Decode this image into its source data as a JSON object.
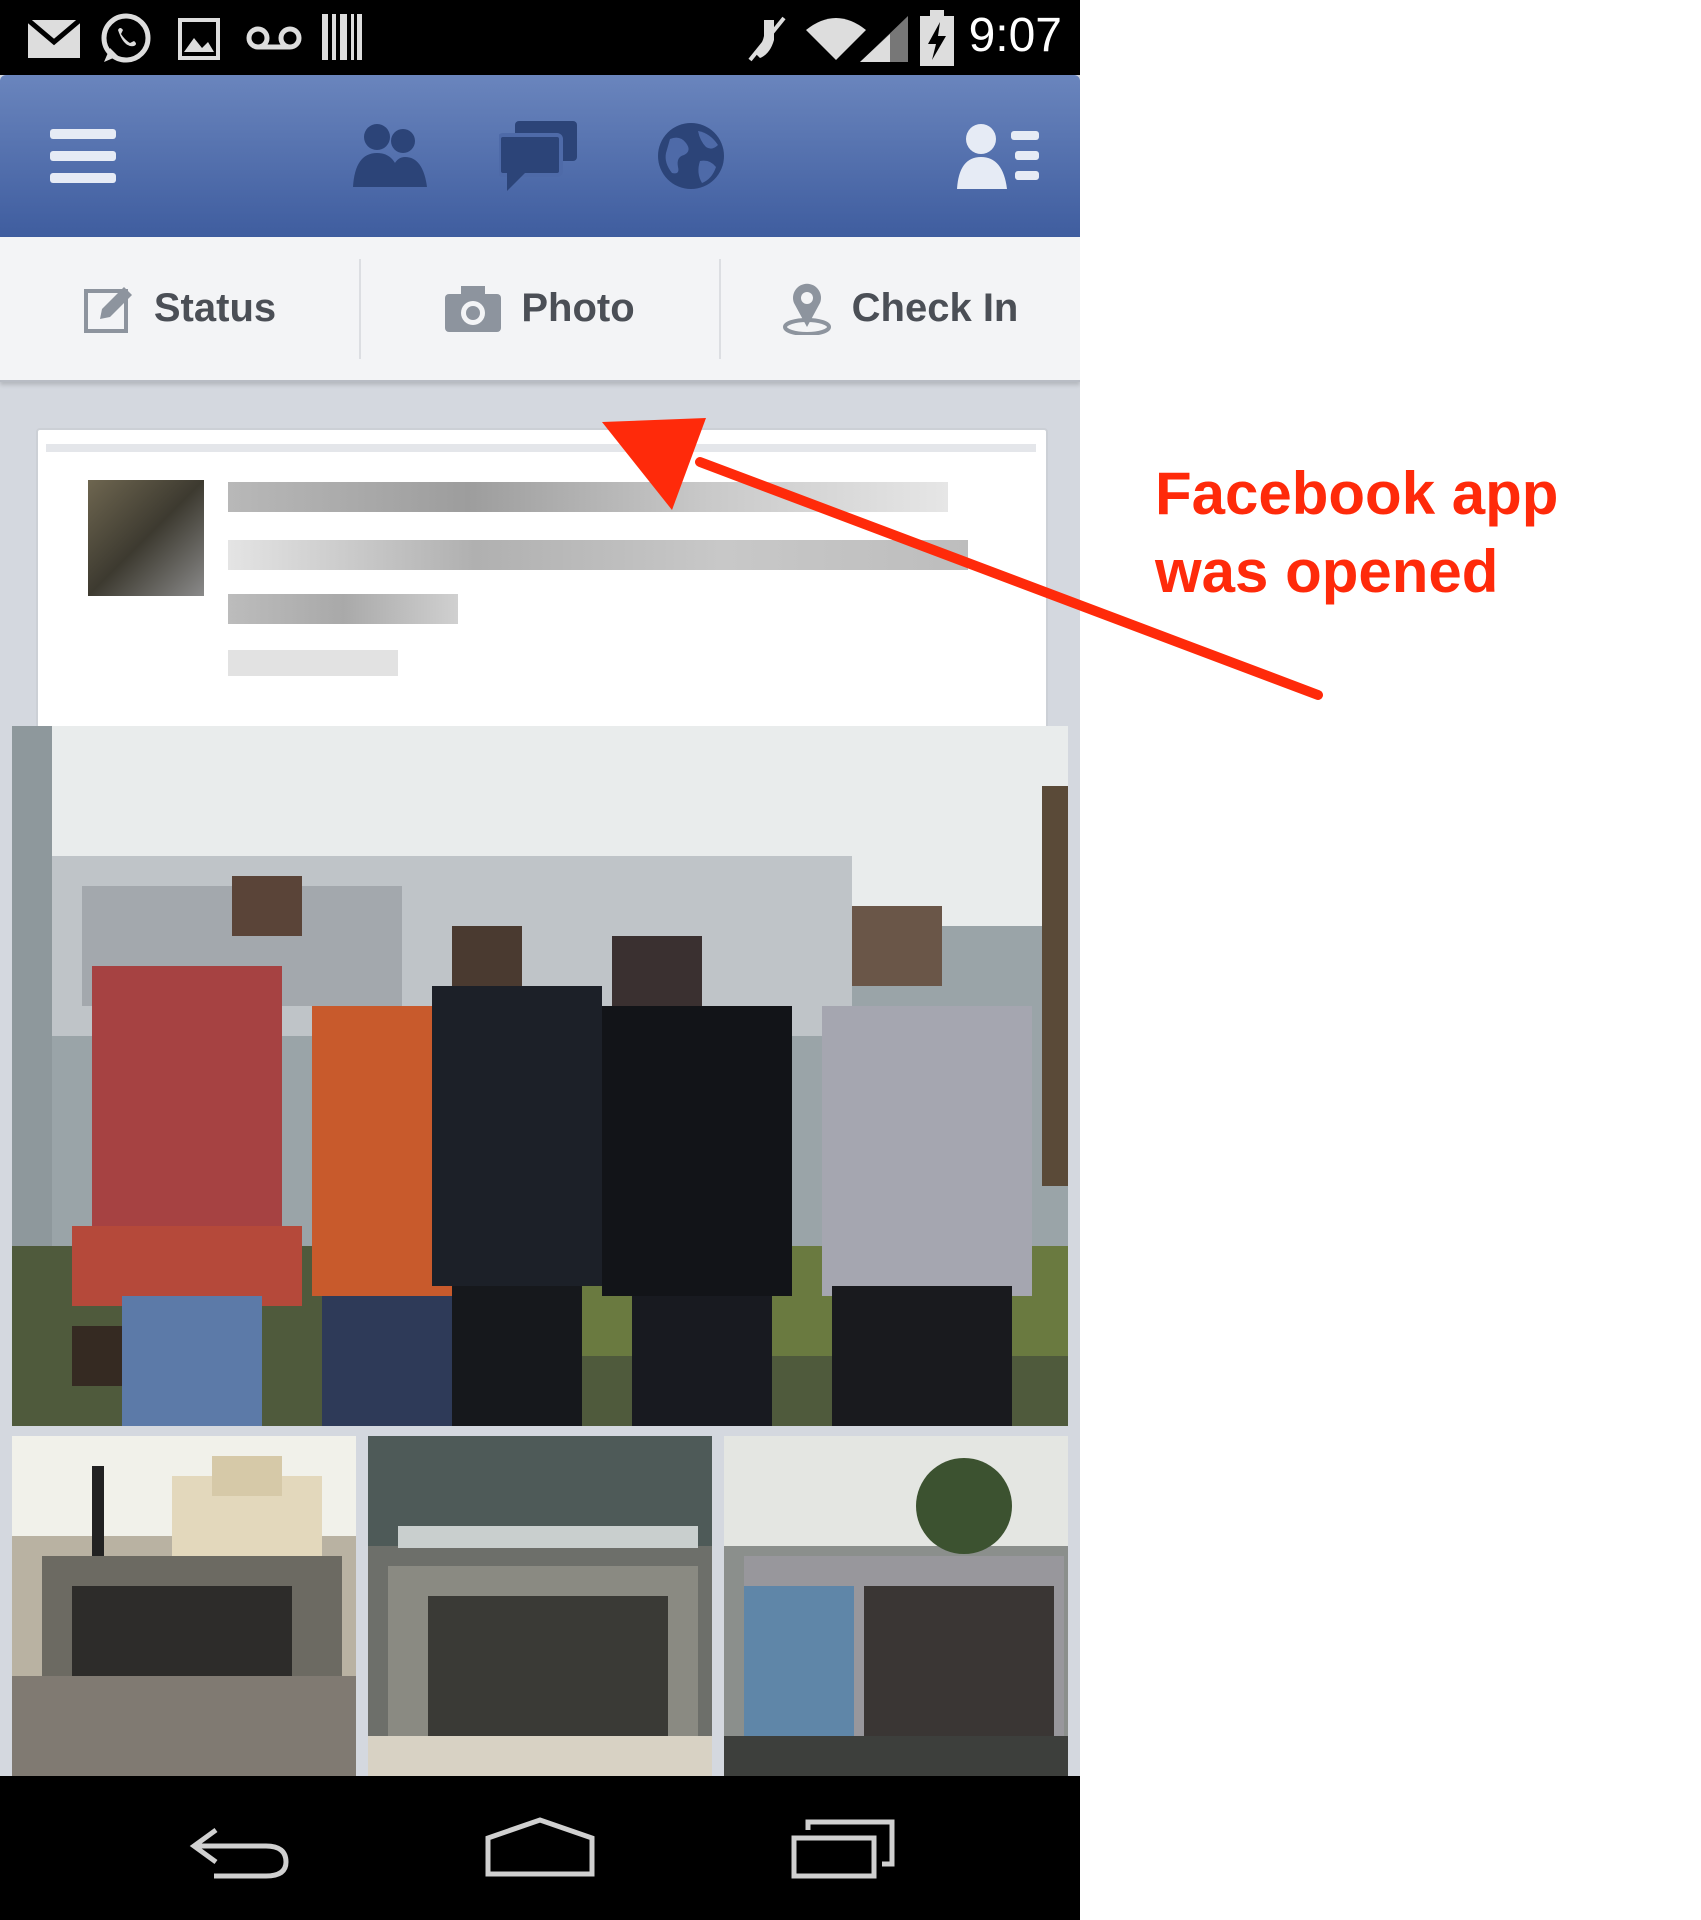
{
  "status_bar": {
    "time": "9:07",
    "left_icons": [
      "mail-icon",
      "whatsapp-icon",
      "gallery-icon",
      "voicemail-icon",
      "barcode-icon"
    ],
    "right_icons": [
      "mute-icon",
      "wifi-icon",
      "signal-icon",
      "battery-charging-icon"
    ]
  },
  "app_bar": {
    "buttons": [
      "menu-icon",
      "friend-requests-icon",
      "messages-icon",
      "notifications-globe-icon",
      "contacts-icon"
    ],
    "accent": "#3f5d9f"
  },
  "composer": {
    "status_label": "Status",
    "photo_label": "Photo",
    "checkin_label": "Check In"
  },
  "annotation": {
    "line1": "Facebook app",
    "line2": "was opened",
    "color": "#ff2a0a"
  },
  "nav_bar": {
    "buttons": [
      "back-icon",
      "home-icon",
      "recent-apps-icon"
    ]
  }
}
